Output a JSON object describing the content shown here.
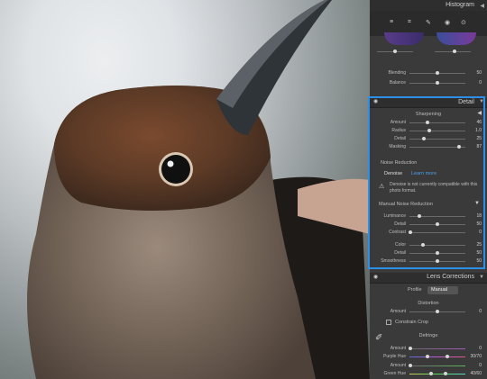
{
  "histogram": {
    "title": "Histogram"
  },
  "tools": [
    {
      "name": "sliders-icon",
      "glyph": "≡"
    },
    {
      "name": "crop-icon",
      "glyph": "⌗"
    },
    {
      "name": "brush-icon",
      "glyph": "✎"
    },
    {
      "name": "redeye-icon",
      "glyph": "◉"
    },
    {
      "name": "preset-icon",
      "glyph": "⊙"
    }
  ],
  "blend": {
    "rows": [
      {
        "label": "Blending",
        "value": "50",
        "pos": 0.5
      },
      {
        "label": "Balance",
        "value": "0",
        "pos": 0.5
      }
    ]
  },
  "detail": {
    "title": "Detail",
    "sharpening": {
      "label": "Sharpening",
      "rows": [
        {
          "label": "Amount",
          "value": "46",
          "pos": 0.3
        },
        {
          "label": "Radius",
          "value": "1.0",
          "pos": 0.35
        },
        {
          "label": "Detail",
          "value": "25",
          "pos": 0.25
        },
        {
          "label": "Masking",
          "value": "87",
          "pos": 0.87
        }
      ]
    },
    "noise": {
      "label": "Noise Reduction",
      "denoise": "Denoise",
      "learn": "Learn more",
      "warning": "Denoise is not currently compatible with this photo format."
    },
    "manual": {
      "label": "Manual Noise Reduction",
      "rows": [
        {
          "label": "Luminance",
          "value": "18",
          "pos": 0.18
        },
        {
          "label": "Detail",
          "value": "50",
          "pos": 0.5
        },
        {
          "label": "Contrast",
          "value": "0",
          "pos": 0.0
        },
        {
          "label": "Color",
          "value": "25",
          "pos": 0.25
        },
        {
          "label": "Detail",
          "value": "50",
          "pos": 0.5
        },
        {
          "label": "Smoothness",
          "value": "50",
          "pos": 0.5
        }
      ]
    }
  },
  "lens": {
    "title": "Lens Corrections",
    "profile": "Profile",
    "manual": "Manual",
    "distortion": "Distortion",
    "amount": {
      "label": "Amount",
      "value": "0",
      "pos": 0.5
    },
    "constrain": "Constrain Crop",
    "defringe": "Defringe",
    "rows": [
      {
        "label": "Amount",
        "value": "0",
        "pos": 0.0
      },
      {
        "label": "Purple Hue",
        "value": "30/70",
        "pos": 0.5
      },
      {
        "label": "Amount",
        "value": "0",
        "pos": 0.0
      },
      {
        "label": "Green Hue",
        "value": "40/60",
        "pos": 0.55
      }
    ]
  }
}
